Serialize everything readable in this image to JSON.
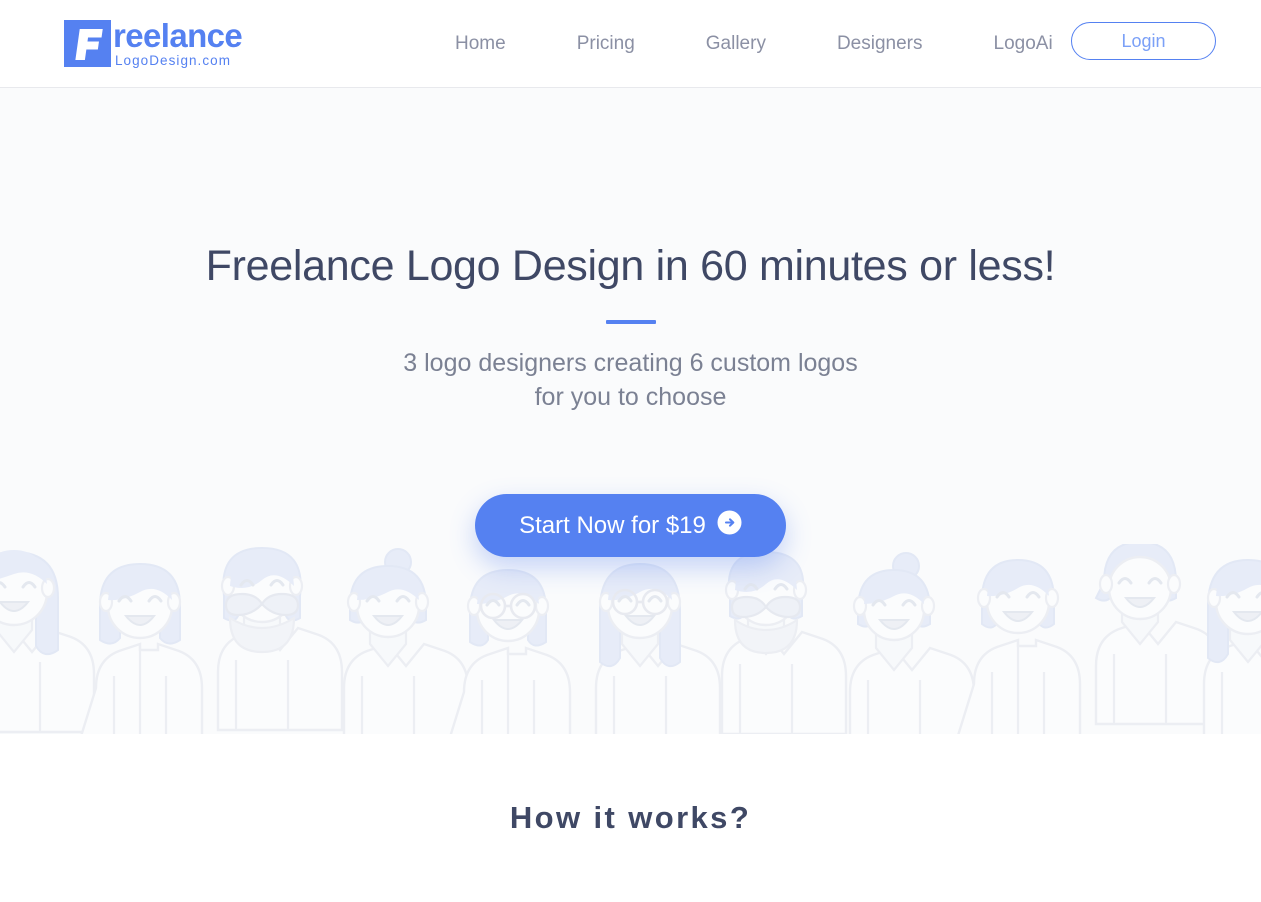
{
  "header": {
    "logo": {
      "mark_letter": "F",
      "word": "reelance",
      "sub": "LogoDesign.com",
      "brand_color": "#5581f1"
    },
    "nav": [
      {
        "label": "Home"
      },
      {
        "label": "Pricing"
      },
      {
        "label": "Gallery"
      },
      {
        "label": "Designers"
      },
      {
        "label": "LogoAi"
      }
    ],
    "login_label": "Login"
  },
  "hero": {
    "title": "Freelance Logo Design in 60 minutes or less!",
    "divider_color": "#5581f1",
    "subtitle_line1": "3 logo designers creating 6 custom logos",
    "subtitle_line2": "for you to choose",
    "cta_label": "Start Now for $19",
    "cta_icon": "arrow-circle-right-icon",
    "cta_color": "#5581f1",
    "background_color": "#fafbfc"
  },
  "how_it_works": {
    "title": "How it works?"
  }
}
